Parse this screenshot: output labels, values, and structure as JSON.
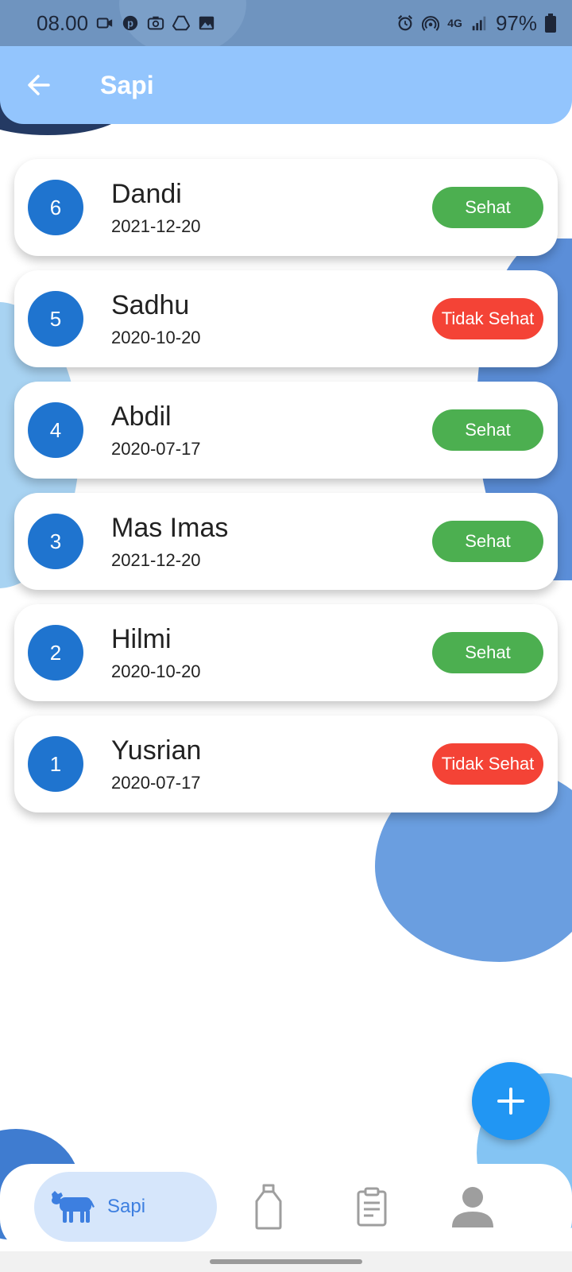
{
  "status_bar": {
    "time": "08.00",
    "network": "4G",
    "battery": "97%",
    "left_icons": [
      "video-icon",
      "pinterest-icon",
      "camera-icon",
      "drive-icon",
      "image-icon"
    ],
    "right_icons": [
      "alarm-icon",
      "hotspot-icon",
      "network-icon",
      "signal-icon",
      "battery-icon"
    ]
  },
  "app_bar": {
    "title": "Sapi",
    "back_icon": "arrow-left-icon",
    "background": "#93c5fd"
  },
  "cows": [
    {
      "number": "6",
      "name": "Dandi",
      "date": "2021-12-20",
      "status": "Sehat",
      "status_color": "#4caf50"
    },
    {
      "number": "5",
      "name": "Sadhu",
      "date": "2020-10-20",
      "status": "Tidak Sehat",
      "status_color": "#f44336"
    },
    {
      "number": "4",
      "name": "Abdil",
      "date": "2020-07-17",
      "status": "Sehat",
      "status_color": "#4caf50"
    },
    {
      "number": "3",
      "name": "Mas Imas",
      "date": "2021-12-20",
      "status": "Sehat",
      "status_color": "#4caf50"
    },
    {
      "number": "2",
      "name": "Hilmi",
      "date": "2020-10-20",
      "status": "Sehat",
      "status_color": "#4caf50"
    },
    {
      "number": "1",
      "name": "Yusrian",
      "date": "2020-07-17",
      "status": "Tidak Sehat",
      "status_color": "#f44336"
    }
  ],
  "fab": {
    "icon": "plus-icon",
    "color": "#2196f3"
  },
  "bottom_nav": {
    "items": [
      {
        "label": "Sapi",
        "icon": "cow-icon",
        "active": true
      },
      {
        "label": "",
        "icon": "milk-bottle-icon",
        "active": false
      },
      {
        "label": "",
        "icon": "clipboard-icon",
        "active": false
      },
      {
        "label": "",
        "icon": "person-icon",
        "active": false
      }
    ],
    "active_color": "#3d7fe0"
  }
}
